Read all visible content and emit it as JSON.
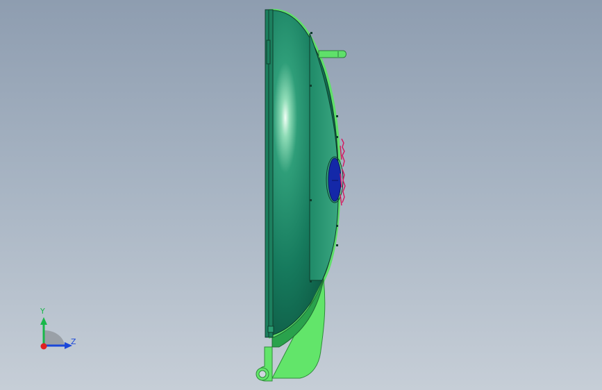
{
  "viewport": {
    "background_top": "#8e9db0",
    "background_bottom": "#c6ced7"
  },
  "model": {
    "description_icon": "dome-shell-side-view",
    "body_color": "#1f8f6a",
    "edge_color": "#5fe06a",
    "bracket_color": "#62e56a",
    "port_color": "#1428a8",
    "highlight_color": "#d6155f"
  },
  "triad": {
    "y_label": "Y",
    "z_label": "Z",
    "y_color": "#19b84a",
    "z_color": "#1b47d9",
    "x_color": "#e02020"
  }
}
